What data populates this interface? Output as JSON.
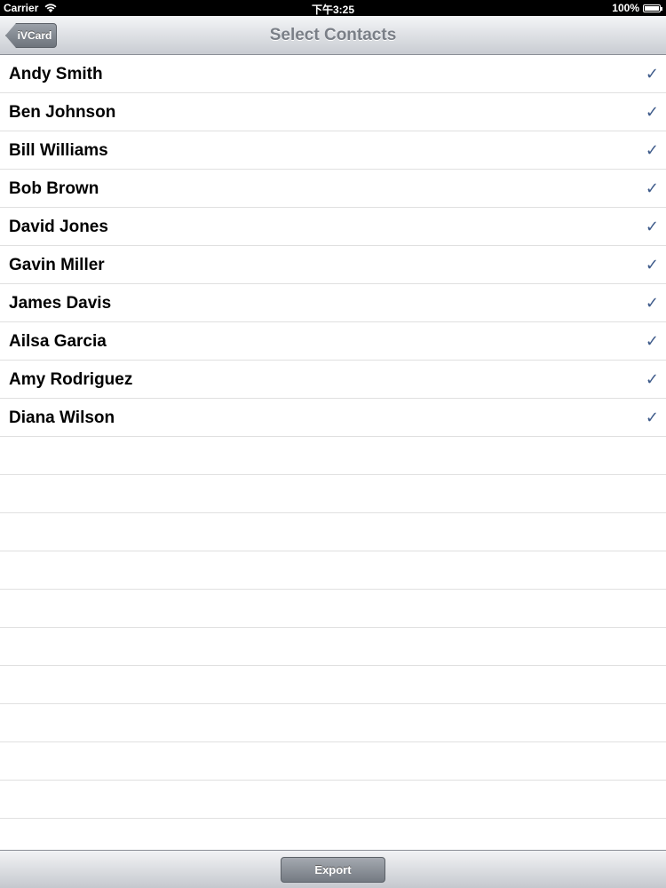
{
  "status_bar": {
    "carrier": "Carrier",
    "time": "下午3:25",
    "battery": "100%"
  },
  "nav": {
    "back_label": "iVCard",
    "title": "Select Contacts"
  },
  "contacts": [
    {
      "name": "Andy Smith",
      "checked": true
    },
    {
      "name": "Ben Johnson",
      "checked": true
    },
    {
      "name": "Bill Williams",
      "checked": true
    },
    {
      "name": "Bob Brown",
      "checked": true
    },
    {
      "name": "David Jones",
      "checked": true
    },
    {
      "name": "Gavin Miller",
      "checked": true
    },
    {
      "name": "James Davis",
      "checked": true
    },
    {
      "name": "Ailsa Garcia",
      "checked": true
    },
    {
      "name": "Amy Rodriguez",
      "checked": true
    },
    {
      "name": "Diana Wilson",
      "checked": true
    }
  ],
  "checkmark": "✓",
  "toolbar": {
    "export_label": "Export"
  }
}
